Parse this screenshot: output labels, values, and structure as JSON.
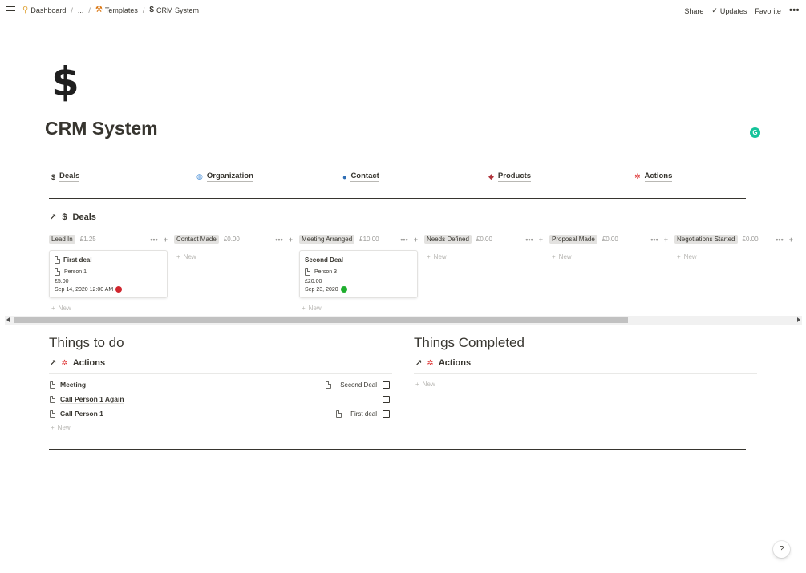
{
  "topbar": {
    "breadcrumbs": [
      {
        "icon": "magnifier-icon",
        "glyph": "⚲",
        "label": "Dashboard"
      },
      {
        "label": "..."
      },
      {
        "icon": "tools-icon",
        "glyph": "⚒",
        "label": "Templates"
      },
      {
        "icon": "dollar-icon",
        "glyph": "$",
        "label": "CRM System"
      }
    ],
    "separator": "/",
    "share_label": "Share",
    "updates_label": "Updates",
    "favorite_label": "Favorite",
    "more_label": "•••"
  },
  "page": {
    "icon_glyph": "$",
    "title": "CRM System",
    "grammarly_glyph": "G"
  },
  "links": [
    {
      "icon": "dollar-icon",
      "glyph": "$",
      "label": "Deals"
    },
    {
      "icon": "globe-icon",
      "glyph": "🌐",
      "label": "Organization"
    },
    {
      "icon": "people-icon",
      "glyph": "👥",
      "label": "Contact"
    },
    {
      "icon": "gem-icon",
      "glyph": "🔴",
      "label": "Products"
    },
    {
      "icon": "sparkle-icon",
      "glyph": "✲",
      "label": "Actions"
    }
  ],
  "board": {
    "arrow": "↗",
    "icon_glyph": "$",
    "title": "Deals",
    "new_label": "New",
    "columns": [
      {
        "name": "Lead In",
        "sum": "£1.25",
        "cards": [
          {
            "title": "First deal",
            "person": "Person 1",
            "amount": "£5.00",
            "date": "Sep 14, 2020 12:00 AM",
            "status_color": "#d0262e"
          }
        ]
      },
      {
        "name": "Contact Made",
        "sum": "£0.00",
        "cards": []
      },
      {
        "name": "Meeting Arranged",
        "sum": "£10.00",
        "cards": [
          {
            "title": "Second Deal",
            "person": "Person 3",
            "amount": "£20.00",
            "date": "Sep 23, 2020",
            "status_color": "#1fae2e"
          }
        ]
      },
      {
        "name": "Needs Defined",
        "sum": "£0.00",
        "cards": []
      },
      {
        "name": "Proposal Made",
        "sum": "£0.00",
        "cards": []
      },
      {
        "name": "Negotiations Started",
        "sum": "£0.00",
        "cards": []
      }
    ],
    "column_more": "•••",
    "column_add": "+"
  },
  "todo": {
    "title": "Things to do",
    "arrow": "↗",
    "list_icon_glyph": "✲",
    "list_title": "Actions",
    "new_label": "New",
    "items": [
      {
        "name": "Meeting",
        "relation": "Second Deal",
        "checked": false
      },
      {
        "name": "Call Person 1 Again",
        "relation": "",
        "checked": false
      },
      {
        "name": "Call Person 1",
        "relation": "First deal",
        "checked": false
      }
    ]
  },
  "completed": {
    "title": "Things Completed",
    "arrow": "↗",
    "list_icon_glyph": "✲",
    "list_title": "Actions",
    "new_label": "New"
  },
  "help_label": "?",
  "colors": {
    "text": "#37352f",
    "muted": "#9b9a97",
    "tag_bg": "#e3e2e0",
    "accent_sparkle": "#e03e3e",
    "grammarly": "#15c39a"
  }
}
